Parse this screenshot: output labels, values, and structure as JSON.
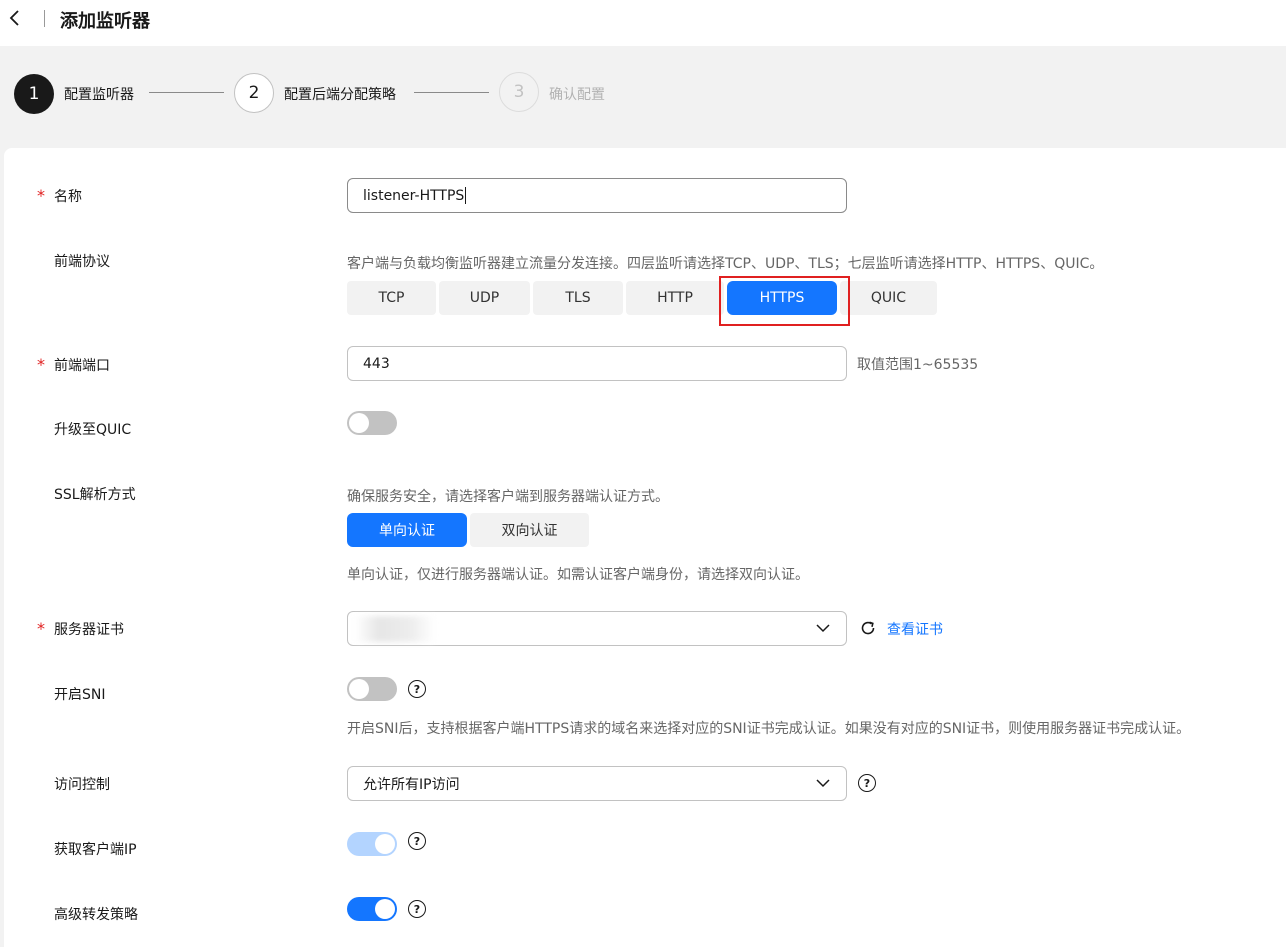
{
  "header": {
    "title": "添加监听器"
  },
  "steps": [
    {
      "num": "1",
      "label": "配置监听器"
    },
    {
      "num": "2",
      "label": "配置后端分配策略"
    },
    {
      "num": "3",
      "label": "确认配置"
    }
  ],
  "form": {
    "name": {
      "label": "名称",
      "value": "listener-HTTPS"
    },
    "protocol": {
      "label": "前端协议",
      "hint": "客户端与负载均衡监听器建立流量分发连接。四层监听请选择TCP、UDP、TLS；七层监听请选择HTTP、HTTPS、QUIC。",
      "options": [
        "TCP",
        "UDP",
        "TLS",
        "HTTP",
        "HTTPS",
        "QUIC"
      ],
      "selected": "HTTPS"
    },
    "port": {
      "label": "前端端口",
      "value": "443",
      "range_hint": "取值范围1~65535"
    },
    "quic_upgrade": {
      "label": "升级至QUIC",
      "enabled": false
    },
    "ssl": {
      "label": "SSL解析方式",
      "hint": "确保服务安全，请选择客户端到服务器端认证方式。",
      "options": [
        "单向认证",
        "双向认证"
      ],
      "selected": "单向认证",
      "desc": "单向认证，仅进行服务器端认证。如需认证客户端身份，请选择双向认证。"
    },
    "server_cert": {
      "label": "服务器证书",
      "view_link": "查看证书"
    },
    "sni": {
      "label": "开启SNI",
      "enabled": false,
      "desc": "开启SNI后，支持根据客户端HTTPS请求的域名来选择对应的SNI证书完成认证。如果没有对应的SNI证书，则使用服务器证书完成认证。"
    },
    "access_control": {
      "label": "访问控制",
      "value": "允许所有IP访问"
    },
    "client_ip": {
      "label": "获取客户端IP",
      "enabled": true
    },
    "advanced_forwarding": {
      "label": "高级转发策略",
      "enabled": true
    }
  },
  "colors": {
    "primary": "#1476ff",
    "required": "#e02020",
    "highlight_box": "#e02020"
  },
  "icons": [
    "back-arrow-icon",
    "chevron-down-icon",
    "refresh-icon",
    "help-icon"
  ]
}
